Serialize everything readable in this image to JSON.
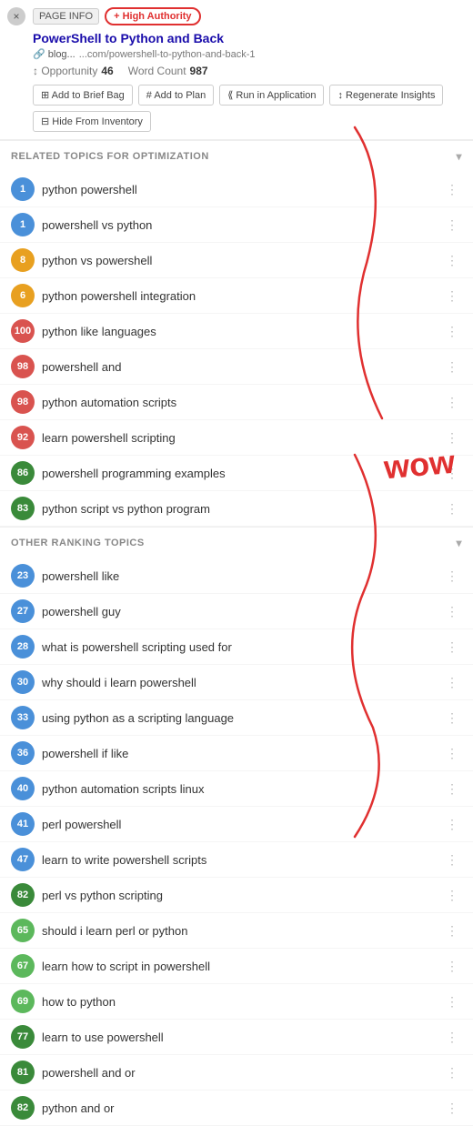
{
  "close_button": "×",
  "header": {
    "tag_page_info": "PAGE INFO",
    "tag_high_authority": "+ High Authority",
    "title": "PowerShell to Python and Back",
    "url_label": "🔗 blog...",
    "url_path": "...com/powershell-to-python-and-back-1",
    "opportunity_label": "↕ Opportunity",
    "opportunity_value": "46",
    "word_count_label": "Word Count",
    "word_count_value": "987",
    "btn_add_brief": "⊞ Add to Brief Bag",
    "btn_add_plan": "# Add to Plan",
    "btn_run_app": "⟪ Run in Application",
    "btn_regenerate": "↕ Regenerate Insights",
    "btn_hide": "⊟ Hide From Inventory"
  },
  "related_topics": {
    "section_label": "RELATED TOPICS FOR OPTIMIZATION",
    "items": [
      {
        "score": 1,
        "color": "score-blue",
        "text": "python powershell"
      },
      {
        "score": 1,
        "color": "score-blue",
        "text": "powershell vs python"
      },
      {
        "score": 8,
        "color": "score-orange",
        "text": "python vs powershell"
      },
      {
        "score": 6,
        "color": "score-orange",
        "text": "python powershell integration"
      },
      {
        "score": 100,
        "color": "score-red",
        "text": "python like languages"
      },
      {
        "score": 98,
        "color": "score-red",
        "text": "powershell and"
      },
      {
        "score": 98,
        "color": "score-red",
        "text": "python automation scripts"
      },
      {
        "score": 92,
        "color": "score-red",
        "text": "learn powershell scripting"
      },
      {
        "score": 86,
        "color": "score-dark-green",
        "text": "powershell programming examples"
      },
      {
        "score": 83,
        "color": "score-dark-green",
        "text": "python script vs python program"
      }
    ]
  },
  "other_ranking": {
    "section_label": "OTHER RANKING TOPICS",
    "items": [
      {
        "score": 23,
        "color": "score-blue",
        "text": "powershell like"
      },
      {
        "score": 27,
        "color": "score-blue",
        "text": "powershell guy"
      },
      {
        "score": 28,
        "color": "score-blue",
        "text": "what is powershell scripting used for"
      },
      {
        "score": 30,
        "color": "score-blue",
        "text": "why should i learn powershell"
      },
      {
        "score": 33,
        "color": "score-blue",
        "text": "using python as a scripting language"
      },
      {
        "score": 36,
        "color": "score-blue",
        "text": "powershell if like"
      },
      {
        "score": 40,
        "color": "score-blue",
        "text": "python automation scripts linux"
      },
      {
        "score": 41,
        "color": "score-blue",
        "text": "perl powershell"
      },
      {
        "score": 47,
        "color": "score-blue",
        "text": "learn to write powershell scripts"
      },
      {
        "score": 82,
        "color": "score-dark-green",
        "text": "perl vs python scripting"
      },
      {
        "score": 65,
        "color": "score-green",
        "text": "should i learn perl or python"
      },
      {
        "score": 67,
        "color": "score-green",
        "text": "learn how to script in powershell"
      },
      {
        "score": 69,
        "color": "score-green",
        "text": "how to python"
      },
      {
        "score": 77,
        "color": "score-dark-green",
        "text": "learn to use powershell"
      },
      {
        "score": 81,
        "color": "score-dark-green",
        "text": "powershell and or"
      },
      {
        "score": 82,
        "color": "score-dark-green",
        "text": "python and or"
      }
    ]
  }
}
